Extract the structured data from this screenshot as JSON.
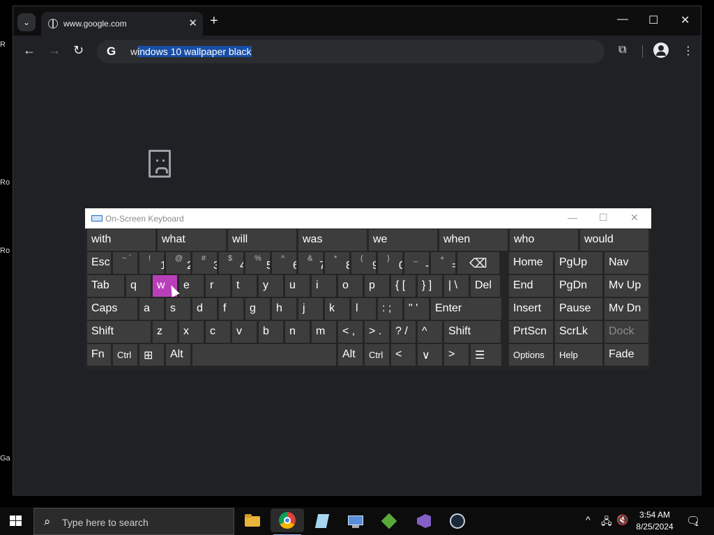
{
  "browser": {
    "tab_title": "www.google.com",
    "tab_close": "✕",
    "new_tab": "+",
    "window_controls": {
      "minimize": "—",
      "maximize": "☐",
      "close": "✕"
    },
    "nav": {
      "back": "←",
      "forward": "→",
      "reload": "↻"
    },
    "omnibox": {
      "prefix": "w",
      "selected": "indows 10 wallpaper black"
    },
    "extensions_icon": "⧉",
    "menu_icon": "⋮",
    "tab_list": "⌄"
  },
  "desktop_labels": [
    "R",
    "Ro",
    "Ro",
    "Ga"
  ],
  "osk": {
    "title": "On-Screen Keyboard",
    "title_controls": {
      "minimize": "—",
      "maximize": "☐",
      "close": "✕"
    },
    "predictions": [
      "with",
      "what",
      "will",
      "was",
      "we",
      "when",
      "who",
      "would"
    ],
    "row1": [
      {
        "label": "Esc"
      },
      {
        "sub": "~ `",
        "main": ""
      },
      {
        "sub": "!",
        "main": "1"
      },
      {
        "sub": "@",
        "main": "2"
      },
      {
        "sub": "#",
        "main": "3"
      },
      {
        "sub": "$",
        "main": "4"
      },
      {
        "sub": "%",
        "main": "5"
      },
      {
        "sub": "^",
        "main": "6"
      },
      {
        "sub": "&",
        "main": "7"
      },
      {
        "sub": "*",
        "main": "8"
      },
      {
        "sub": "(",
        "main": "9"
      },
      {
        "sub": ")",
        "main": "0"
      },
      {
        "sub": "_",
        "main": "-"
      },
      {
        "sub": "+",
        "main": "="
      },
      {
        "label": "⌫"
      }
    ],
    "row2": [
      "Tab",
      "q",
      "w",
      "e",
      "r",
      "t",
      "y",
      "u",
      "i",
      "o",
      "p",
      "{ [",
      "} ]",
      "| \\",
      "Del"
    ],
    "row3": [
      "Caps",
      "a",
      "s",
      "d",
      "f",
      "g",
      "h",
      "j",
      "k",
      "l",
      ": ;",
      "\" '",
      "Enter"
    ],
    "row4": [
      "Shift",
      "z",
      "x",
      "c",
      "v",
      "b",
      "n",
      "m",
      "< ,",
      "> .",
      "? /",
      "^",
      "Shift"
    ],
    "row5": [
      "Fn",
      "Ctrl",
      "⊞",
      "Alt",
      "",
      "Alt",
      "Ctrl",
      "<",
      "∨",
      ">",
      "☰"
    ],
    "nav_keys": [
      [
        "Home",
        "PgUp",
        "Nav"
      ],
      [
        "End",
        "PgDn",
        "Mv Up"
      ],
      [
        "Insert",
        "Pause",
        "Mv Dn"
      ],
      [
        "PrtScn",
        "ScrLk",
        "Dock"
      ],
      [
        "Options",
        "Help",
        "Fade"
      ]
    ]
  },
  "taskbar": {
    "search_placeholder": "Type here to search",
    "search_icon": "⌕",
    "apps": [
      "file-explorer",
      "chrome",
      "notepad",
      "control-panel",
      "minecraft",
      "visual-studio",
      "steam"
    ],
    "tray": {
      "chevron": "^",
      "network": "🖧",
      "volume": "🔇"
    },
    "time": "3:54 AM",
    "date": "8/25/2024",
    "notification_icon": "🗨",
    "notification_count": "1"
  }
}
